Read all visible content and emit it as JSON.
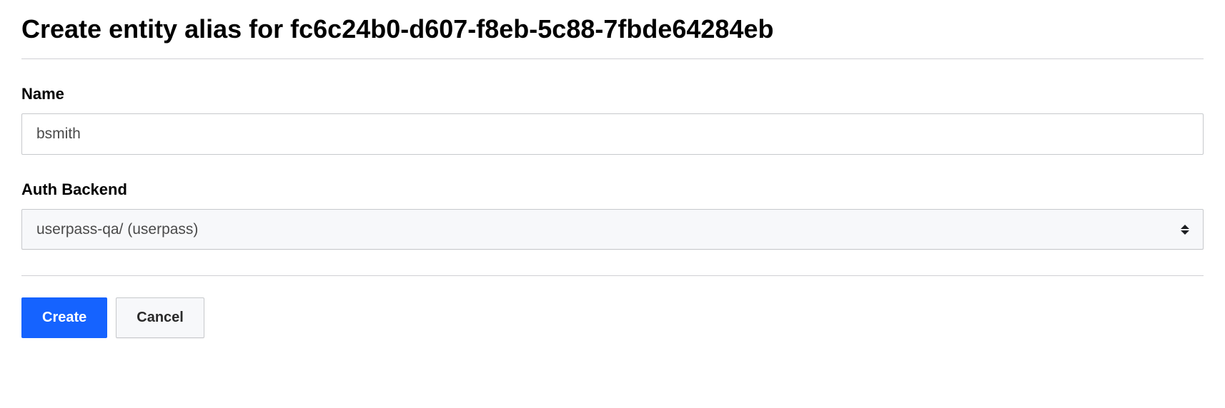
{
  "header": {
    "title": "Create entity alias for fc6c24b0-d607-f8eb-5c88-7fbde64284eb"
  },
  "form": {
    "name": {
      "label": "Name",
      "value": "bsmith"
    },
    "authBackend": {
      "label": "Auth Backend",
      "selected": "userpass-qa/ (userpass)"
    }
  },
  "actions": {
    "create": "Create",
    "cancel": "Cancel"
  }
}
